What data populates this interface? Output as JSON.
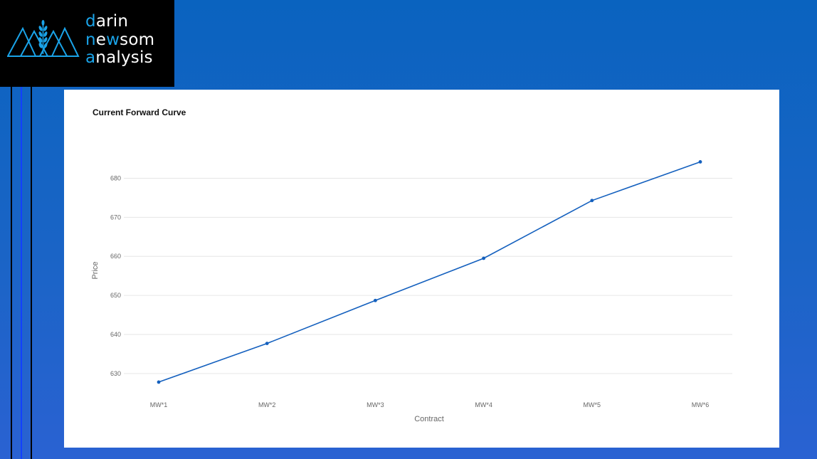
{
  "logo": {
    "line1_initial": "d",
    "line1_rest": "arin",
    "line2_a": "n",
    "line2_b": "e",
    "line2_c": "w",
    "line2_d": "som",
    "line3_initial": "a",
    "line3_rest": "nalysis",
    "brand_color": "#1aa3e8"
  },
  "chart_data": {
    "type": "line",
    "title": "Current Forward Curve",
    "xlabel": "Contract",
    "ylabel": "Price",
    "categories": [
      "MW*1",
      "MW*2",
      "MW*3",
      "MW*4",
      "MW*5",
      "MW*6"
    ],
    "series": [
      {
        "values": [
          627.8,
          637.7,
          648.7,
          659.5,
          674.3,
          684.2
        ],
        "color": "#1460be"
      }
    ],
    "yticks": [
      630,
      640,
      650,
      660,
      670,
      680
    ],
    "ylim": [
      625.6,
      687.2
    ],
    "grid": true
  }
}
